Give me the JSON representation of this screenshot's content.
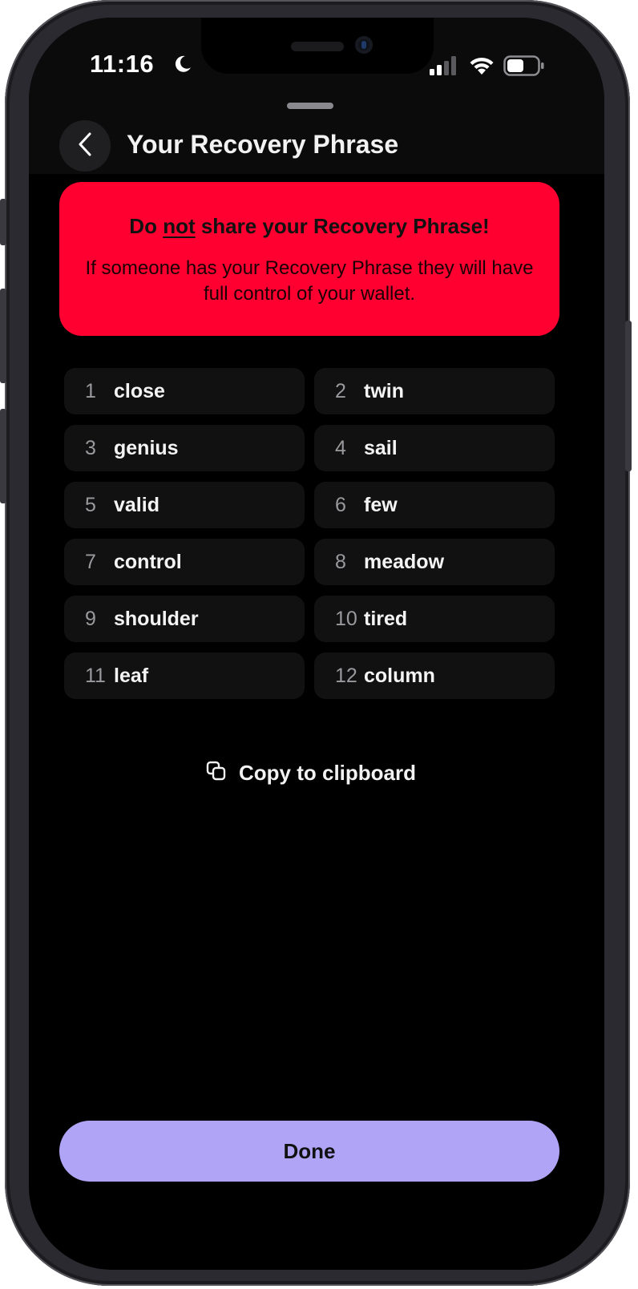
{
  "status_bar": {
    "time": "11:16",
    "moon_icon": "moon-icon",
    "signal_icon": "cellular-signal-icon",
    "wifi_icon": "wifi-icon",
    "battery_icon": "battery-icon"
  },
  "header": {
    "title": "Your Recovery Phrase",
    "back_icon": "chevron-left-icon"
  },
  "warning": {
    "title_prefix": "Do ",
    "title_emphasis": "not",
    "title_suffix": " share your Recovery Phrase!",
    "body": "If someone has your Recovery Phrase they will have full control of your wallet.",
    "color": "#ff0030"
  },
  "phrase": {
    "words": [
      {
        "num": "1",
        "word": "close"
      },
      {
        "num": "2",
        "word": "twin"
      },
      {
        "num": "3",
        "word": "genius"
      },
      {
        "num": "4",
        "word": "sail"
      },
      {
        "num": "5",
        "word": "valid"
      },
      {
        "num": "6",
        "word": "few"
      },
      {
        "num": "7",
        "word": "control"
      },
      {
        "num": "8",
        "word": "meadow"
      },
      {
        "num": "9",
        "word": "shoulder"
      },
      {
        "num": "10",
        "word": "tired"
      },
      {
        "num": "11",
        "word": "leaf"
      },
      {
        "num": "12",
        "word": "column"
      }
    ]
  },
  "copy": {
    "label": "Copy to clipboard",
    "icon": "copy-icon"
  },
  "footer": {
    "done_label": "Done",
    "accent": "#b0a4f7"
  }
}
